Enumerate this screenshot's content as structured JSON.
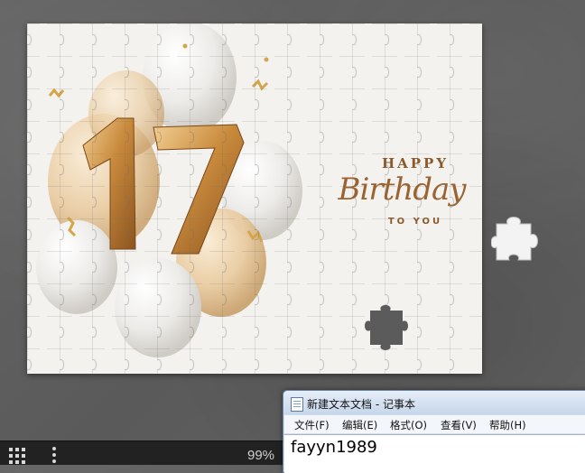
{
  "puzzle": {
    "image_caption": {
      "happy": "HAPPY",
      "birthday": "Birthday",
      "to_you": "TO YOU",
      "number": "17"
    }
  },
  "toolbar": {
    "zoom_percent": "99%",
    "grid_icon": "grid-icon",
    "more_icon": "more-vertical-icon"
  },
  "notepad": {
    "title": "新建文本文档 - 记事本",
    "menu": [
      "文件(F)",
      "编辑(E)",
      "格式(O)",
      "查看(V)",
      "帮助(H)"
    ],
    "content": "fayyn1989"
  },
  "colors": {
    "background": "#5f5f5f",
    "gold": "#c98a3c",
    "caption": "#8a5a2c"
  }
}
